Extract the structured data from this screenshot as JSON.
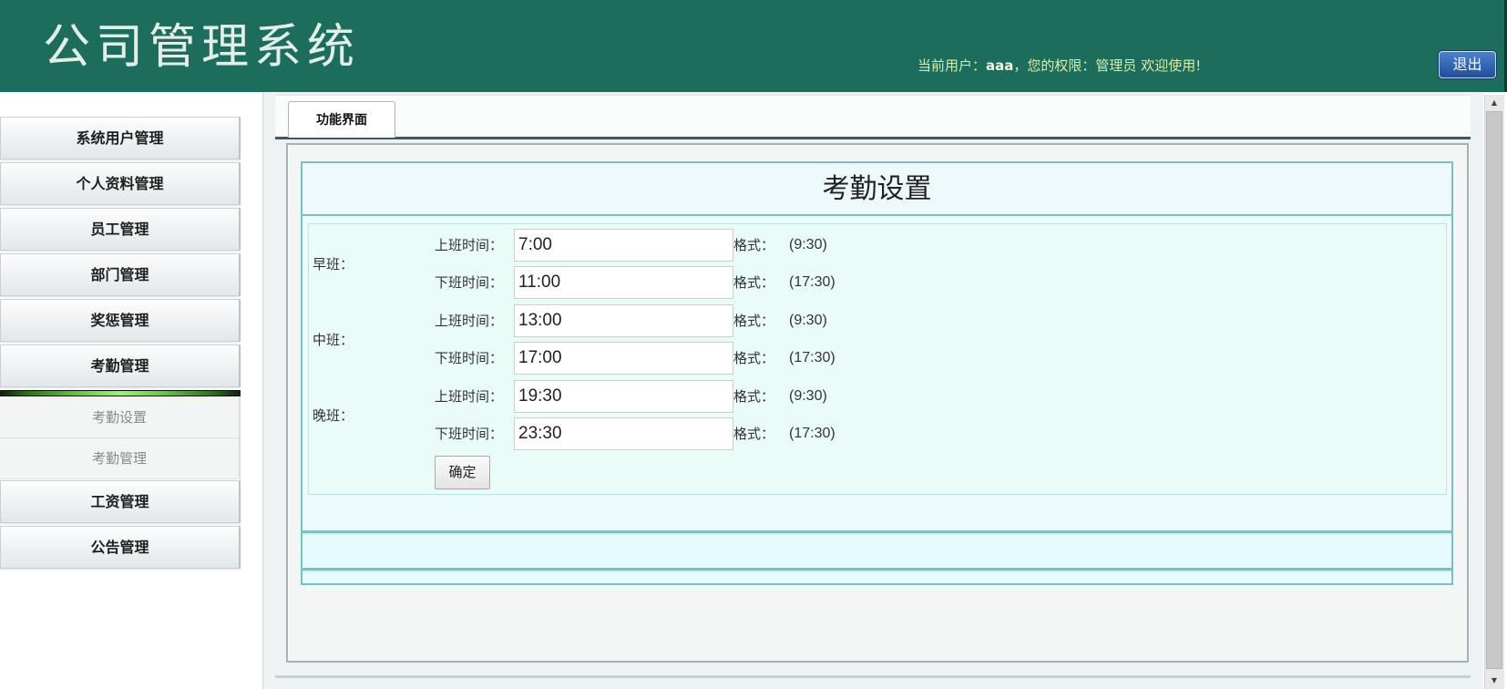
{
  "app": {
    "title": "公司管理系统"
  },
  "header": {
    "user_label": "当前用户：",
    "username": "aaa",
    "role_label": "，您的权限：",
    "role": "管理员",
    "welcome": "欢迎使用!",
    "logout": "退出"
  },
  "sidebar": {
    "items": [
      {
        "label": "系统用户管理"
      },
      {
        "label": "个人资料管理"
      },
      {
        "label": "员工管理"
      },
      {
        "label": "部门管理"
      },
      {
        "label": "奖惩管理"
      },
      {
        "label": "考勤管理",
        "expanded": true
      },
      {
        "label": "工资管理"
      },
      {
        "label": "公告管理"
      }
    ],
    "submenu": [
      {
        "label": "考勤设置"
      },
      {
        "label": "考勤管理"
      }
    ]
  },
  "tabs": [
    {
      "label": "功能界面",
      "active": true
    }
  ],
  "form": {
    "title": "考勤设置",
    "shifts": [
      {
        "name": "早班：",
        "rows": [
          {
            "label": "上班时间：",
            "value": "7:00",
            "format_label": "格式：",
            "format": "(9:30)"
          },
          {
            "label": "下班时间：",
            "value": "11:00",
            "format_label": "格式：",
            "format": "(17:30)"
          }
        ]
      },
      {
        "name": "中班：",
        "rows": [
          {
            "label": "上班时间：",
            "value": "13:00",
            "format_label": "格式：",
            "format": "(9:30)"
          },
          {
            "label": "下班时间：",
            "value": "17:00",
            "format_label": "格式：",
            "format": "(17:30)"
          }
        ]
      },
      {
        "name": "晚班：",
        "rows": [
          {
            "label": "上班时间：",
            "value": "19:30",
            "format_label": "格式：",
            "format": "(9:30)"
          },
          {
            "label": "下班时间：",
            "value": "23:30",
            "format_label": "格式：",
            "format": "(17:30)"
          }
        ]
      }
    ],
    "submit": "确定"
  },
  "scrollbar": {
    "up_icon": "scroll-up-icon",
    "down_icon": "scroll-down-icon"
  },
  "colors": {
    "header_bg": "#1c6d5b",
    "logout_bg": "#2a62b4",
    "table_border": "#74c1c6",
    "form_bg": "#e9fcf8"
  }
}
